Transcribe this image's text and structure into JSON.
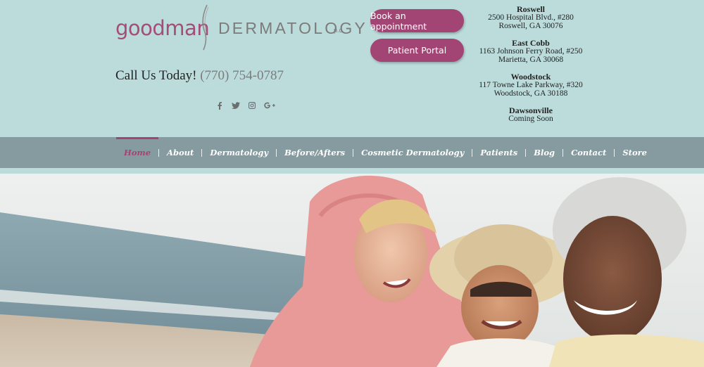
{
  "logo": {
    "brand": "goodman",
    "practice": "DERMATOLOGY",
    "suffix": "p.c."
  },
  "contact": {
    "call_label": "Call Us Today!",
    "phone": "(770) 754-0787"
  },
  "social": [
    {
      "icon": "facebook-icon"
    },
    {
      "icon": "twitter-icon"
    },
    {
      "icon": "instagram-icon"
    },
    {
      "icon": "google-plus-icon"
    }
  ],
  "buttons": {
    "book": "Book an appointment",
    "portal": "Patient Portal"
  },
  "locations": [
    {
      "name": "Roswell",
      "line1": "2500 Hospital Blvd., #280",
      "line2": "Roswell, GA 30076"
    },
    {
      "name": "East Cobb",
      "line1": "1163 Johnson Ferry Road, #250",
      "line2": "Marietta, GA 30068"
    },
    {
      "name": "Woodstock",
      "line1": "117 Towne Lake Parkway, #320",
      "line2": "Woodstock, GA 30188"
    },
    {
      "name": "Dawsonville",
      "line1": "Coming Soon",
      "line2": ""
    }
  ],
  "nav": [
    {
      "label": "Home",
      "active": true
    },
    {
      "label": "About"
    },
    {
      "label": "Dermatology"
    },
    {
      "label": "Before/Afters"
    },
    {
      "label": "Cosmetic Dermatology"
    },
    {
      "label": "Patients"
    },
    {
      "label": "Blog"
    },
    {
      "label": "Contact"
    },
    {
      "label": "Store"
    }
  ],
  "colors": {
    "header_bg": "#bcdcdb",
    "brand_plum": "#a24574",
    "nav_bg": "#869ba0"
  }
}
